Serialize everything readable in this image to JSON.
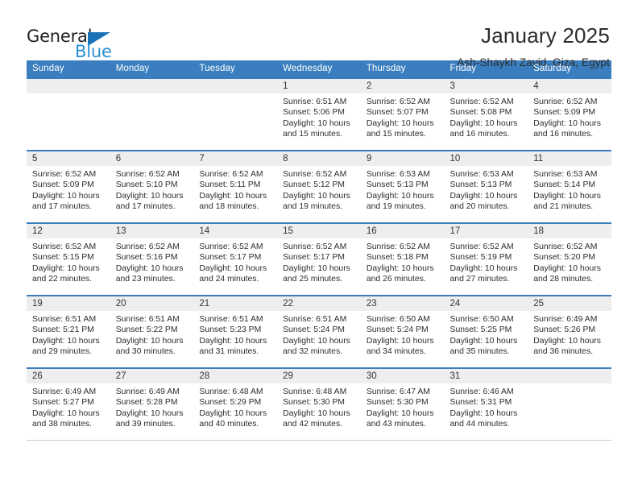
{
  "brand": {
    "name_part1": "General",
    "name_part2": "Blue",
    "accent_color": "#2a8fd4",
    "triangle_color": "#1a72b8"
  },
  "header": {
    "title": "January 2025",
    "subtitle": "Ash-Shaykh Zayid, Giza, Egypt",
    "header_bg_color": "#3a7ebf"
  },
  "calendar": {
    "weekdays": [
      "Sunday",
      "Monday",
      "Tuesday",
      "Wednesday",
      "Thursday",
      "Friday",
      "Saturday"
    ],
    "weeks": [
      [
        {
          "day": "",
          "sunrise": "",
          "sunset": "",
          "daylight1": "",
          "daylight2": ""
        },
        {
          "day": "",
          "sunrise": "",
          "sunset": "",
          "daylight1": "",
          "daylight2": ""
        },
        {
          "day": "",
          "sunrise": "",
          "sunset": "",
          "daylight1": "",
          "daylight2": ""
        },
        {
          "day": "1",
          "sunrise": "Sunrise: 6:51 AM",
          "sunset": "Sunset: 5:06 PM",
          "daylight1": "Daylight: 10 hours",
          "daylight2": "and 15 minutes."
        },
        {
          "day": "2",
          "sunrise": "Sunrise: 6:52 AM",
          "sunset": "Sunset: 5:07 PM",
          "daylight1": "Daylight: 10 hours",
          "daylight2": "and 15 minutes."
        },
        {
          "day": "3",
          "sunrise": "Sunrise: 6:52 AM",
          "sunset": "Sunset: 5:08 PM",
          "daylight1": "Daylight: 10 hours",
          "daylight2": "and 16 minutes."
        },
        {
          "day": "4",
          "sunrise": "Sunrise: 6:52 AM",
          "sunset": "Sunset: 5:09 PM",
          "daylight1": "Daylight: 10 hours",
          "daylight2": "and 16 minutes."
        }
      ],
      [
        {
          "day": "5",
          "sunrise": "Sunrise: 6:52 AM",
          "sunset": "Sunset: 5:09 PM",
          "daylight1": "Daylight: 10 hours",
          "daylight2": "and 17 minutes."
        },
        {
          "day": "6",
          "sunrise": "Sunrise: 6:52 AM",
          "sunset": "Sunset: 5:10 PM",
          "daylight1": "Daylight: 10 hours",
          "daylight2": "and 17 minutes."
        },
        {
          "day": "7",
          "sunrise": "Sunrise: 6:52 AM",
          "sunset": "Sunset: 5:11 PM",
          "daylight1": "Daylight: 10 hours",
          "daylight2": "and 18 minutes."
        },
        {
          "day": "8",
          "sunrise": "Sunrise: 6:52 AM",
          "sunset": "Sunset: 5:12 PM",
          "daylight1": "Daylight: 10 hours",
          "daylight2": "and 19 minutes."
        },
        {
          "day": "9",
          "sunrise": "Sunrise: 6:53 AM",
          "sunset": "Sunset: 5:13 PM",
          "daylight1": "Daylight: 10 hours",
          "daylight2": "and 19 minutes."
        },
        {
          "day": "10",
          "sunrise": "Sunrise: 6:53 AM",
          "sunset": "Sunset: 5:13 PM",
          "daylight1": "Daylight: 10 hours",
          "daylight2": "and 20 minutes."
        },
        {
          "day": "11",
          "sunrise": "Sunrise: 6:53 AM",
          "sunset": "Sunset: 5:14 PM",
          "daylight1": "Daylight: 10 hours",
          "daylight2": "and 21 minutes."
        }
      ],
      [
        {
          "day": "12",
          "sunrise": "Sunrise: 6:52 AM",
          "sunset": "Sunset: 5:15 PM",
          "daylight1": "Daylight: 10 hours",
          "daylight2": "and 22 minutes."
        },
        {
          "day": "13",
          "sunrise": "Sunrise: 6:52 AM",
          "sunset": "Sunset: 5:16 PM",
          "daylight1": "Daylight: 10 hours",
          "daylight2": "and 23 minutes."
        },
        {
          "day": "14",
          "sunrise": "Sunrise: 6:52 AM",
          "sunset": "Sunset: 5:17 PM",
          "daylight1": "Daylight: 10 hours",
          "daylight2": "and 24 minutes."
        },
        {
          "day": "15",
          "sunrise": "Sunrise: 6:52 AM",
          "sunset": "Sunset: 5:17 PM",
          "daylight1": "Daylight: 10 hours",
          "daylight2": "and 25 minutes."
        },
        {
          "day": "16",
          "sunrise": "Sunrise: 6:52 AM",
          "sunset": "Sunset: 5:18 PM",
          "daylight1": "Daylight: 10 hours",
          "daylight2": "and 26 minutes."
        },
        {
          "day": "17",
          "sunrise": "Sunrise: 6:52 AM",
          "sunset": "Sunset: 5:19 PM",
          "daylight1": "Daylight: 10 hours",
          "daylight2": "and 27 minutes."
        },
        {
          "day": "18",
          "sunrise": "Sunrise: 6:52 AM",
          "sunset": "Sunset: 5:20 PM",
          "daylight1": "Daylight: 10 hours",
          "daylight2": "and 28 minutes."
        }
      ],
      [
        {
          "day": "19",
          "sunrise": "Sunrise: 6:51 AM",
          "sunset": "Sunset: 5:21 PM",
          "daylight1": "Daylight: 10 hours",
          "daylight2": "and 29 minutes."
        },
        {
          "day": "20",
          "sunrise": "Sunrise: 6:51 AM",
          "sunset": "Sunset: 5:22 PM",
          "daylight1": "Daylight: 10 hours",
          "daylight2": "and 30 minutes."
        },
        {
          "day": "21",
          "sunrise": "Sunrise: 6:51 AM",
          "sunset": "Sunset: 5:23 PM",
          "daylight1": "Daylight: 10 hours",
          "daylight2": "and 31 minutes."
        },
        {
          "day": "22",
          "sunrise": "Sunrise: 6:51 AM",
          "sunset": "Sunset: 5:24 PM",
          "daylight1": "Daylight: 10 hours",
          "daylight2": "and 32 minutes."
        },
        {
          "day": "23",
          "sunrise": "Sunrise: 6:50 AM",
          "sunset": "Sunset: 5:24 PM",
          "daylight1": "Daylight: 10 hours",
          "daylight2": "and 34 minutes."
        },
        {
          "day": "24",
          "sunrise": "Sunrise: 6:50 AM",
          "sunset": "Sunset: 5:25 PM",
          "daylight1": "Daylight: 10 hours",
          "daylight2": "and 35 minutes."
        },
        {
          "day": "25",
          "sunrise": "Sunrise: 6:49 AM",
          "sunset": "Sunset: 5:26 PM",
          "daylight1": "Daylight: 10 hours",
          "daylight2": "and 36 minutes."
        }
      ],
      [
        {
          "day": "26",
          "sunrise": "Sunrise: 6:49 AM",
          "sunset": "Sunset: 5:27 PM",
          "daylight1": "Daylight: 10 hours",
          "daylight2": "and 38 minutes."
        },
        {
          "day": "27",
          "sunrise": "Sunrise: 6:49 AM",
          "sunset": "Sunset: 5:28 PM",
          "daylight1": "Daylight: 10 hours",
          "daylight2": "and 39 minutes."
        },
        {
          "day": "28",
          "sunrise": "Sunrise: 6:48 AM",
          "sunset": "Sunset: 5:29 PM",
          "daylight1": "Daylight: 10 hours",
          "daylight2": "and 40 minutes."
        },
        {
          "day": "29",
          "sunrise": "Sunrise: 6:48 AM",
          "sunset": "Sunset: 5:30 PM",
          "daylight1": "Daylight: 10 hours",
          "daylight2": "and 42 minutes."
        },
        {
          "day": "30",
          "sunrise": "Sunrise: 6:47 AM",
          "sunset": "Sunset: 5:30 PM",
          "daylight1": "Daylight: 10 hours",
          "daylight2": "and 43 minutes."
        },
        {
          "day": "31",
          "sunrise": "Sunrise: 6:46 AM",
          "sunset": "Sunset: 5:31 PM",
          "daylight1": "Daylight: 10 hours",
          "daylight2": "and 44 minutes."
        },
        {
          "day": "",
          "sunrise": "",
          "sunset": "",
          "daylight1": "",
          "daylight2": ""
        }
      ]
    ]
  }
}
